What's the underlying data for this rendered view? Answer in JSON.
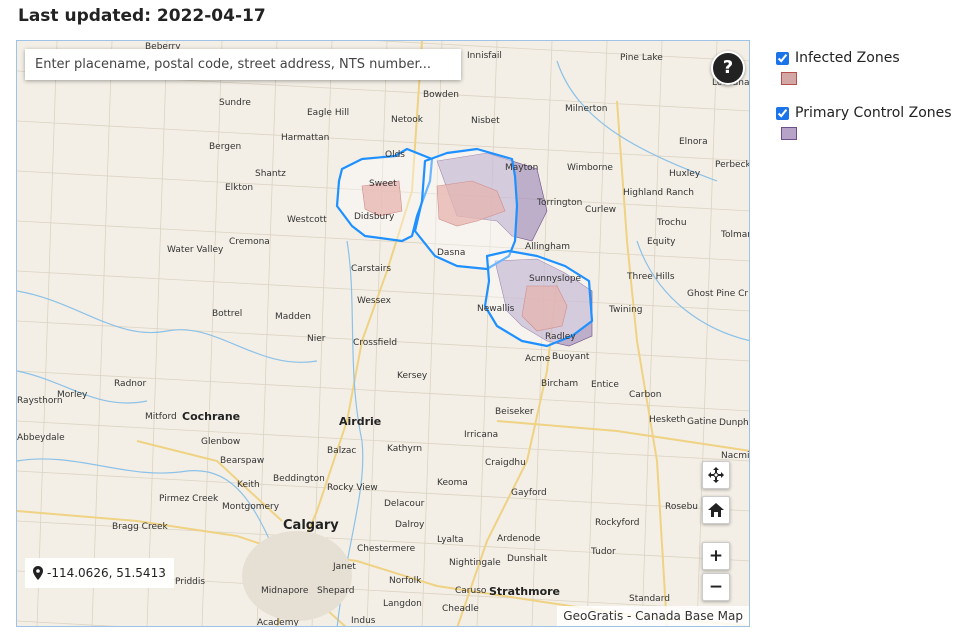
{
  "header": {
    "last_updated": "Last updated: 2022-04-17"
  },
  "map": {
    "search_placeholder": "Enter placename, postal code, street address, NTS number...",
    "help_label": "?",
    "coordinates": "-114.0626, 51.5413",
    "attribution": "GeoGratis - Canada Base Map",
    "zoom_in_label": "+",
    "zoom_out_label": "−",
    "places": [
      "Innisfail",
      "Pine Lake",
      "Lousana",
      "Bowden",
      "Sundre",
      "Eagle Hill",
      "Netook",
      "Nisbet",
      "Milnerton",
      "Harmattan",
      "Elnora",
      "Bergen",
      "Olds",
      "Huxley",
      "Perbeck",
      "Shantz",
      "Mayton",
      "Wimborne",
      "Elkton",
      "Highland Ranch",
      "Torrington",
      "Curlew",
      "Westcott",
      "Didsbury",
      "Trochu",
      "Tolman",
      "Cremona",
      "Water Valley",
      "Equity",
      "Allingham",
      "Carstairs",
      "Three Hills",
      "Sunnyslope",
      "Ghost Pine Cr",
      "Wessex",
      "Bottrel",
      "Madden",
      "Twining",
      "Nier",
      "Crossfield",
      "Acme",
      "Buoyant",
      "Kersey",
      "Radnor",
      "Bircham",
      "Entice",
      "Carbon",
      "Morley",
      "Mitford",
      "Cochrane",
      "Airdrie",
      "Beiseker",
      "Hesketh",
      "Gatine",
      "Dunph",
      "Abbeydale",
      "Glenbow",
      "Irricana",
      "Nacmi",
      "Balzac",
      "Bearspaw",
      "Craigdhu",
      "Beddington",
      "Kathyrn",
      "Keith",
      "Rocky View",
      "Keoma",
      "Gayford",
      "Pirmez Creek",
      "Delacour",
      "Montgomery",
      "Rosebu",
      "Bragg Creek",
      "Calgary",
      "Dalroy",
      "Rockyford",
      "Lyalta",
      "Ardenode",
      "Chestermere",
      "Nightingale",
      "Dunshalt",
      "Tudor",
      "Janet",
      "Priddis",
      "Norfolk",
      "Midnapore",
      "Shepard",
      "Caruso",
      "Strathmore",
      "Standard",
      "Langdon",
      "Cheadle",
      "Indus",
      "Academy",
      "Raysthorn",
      "Dasna",
      "Newallis",
      "Radley",
      "Sweet",
      "Beberry"
    ]
  },
  "legend": {
    "items": [
      {
        "label": "Infected Zones",
        "checked": true,
        "fill": "#d3a7a6",
        "stroke": "#b5504c"
      },
      {
        "label": "Primary Control Zones",
        "checked": true,
        "fill": "#b7a3c8",
        "stroke": "#6e4f8a"
      }
    ]
  },
  "colors": {
    "control_zone_fill": "#9a84b8",
    "infected_zone_fill": "#d98c86",
    "zone_outline": "#1e90ff",
    "river": "#8fc3ea",
    "road": "#f1d58a",
    "grid": "#d8cfbe"
  }
}
